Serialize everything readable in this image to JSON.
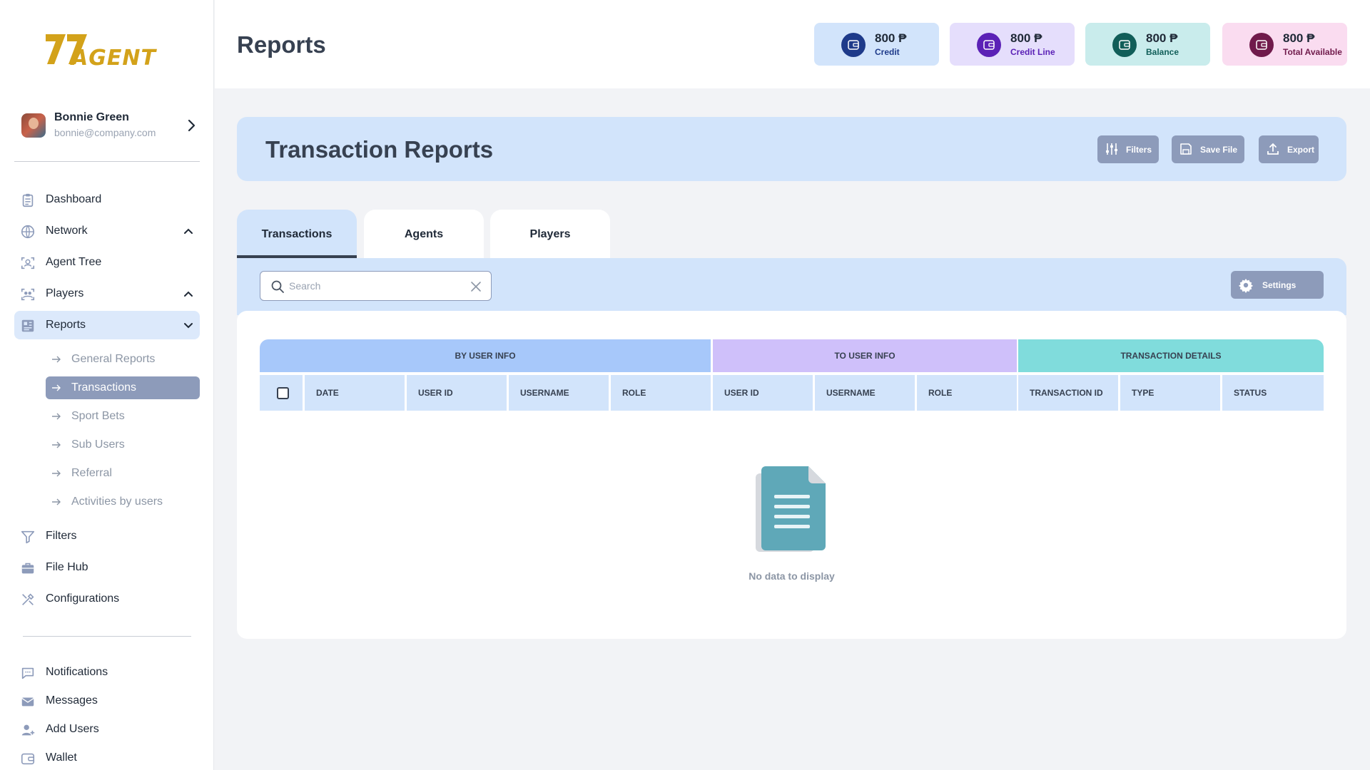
{
  "brand": {
    "logo_text": "AGENT"
  },
  "profile": {
    "name": "Bonnie Green",
    "email": "bonnie@company.com"
  },
  "nav": {
    "dashboard": "Dashboard",
    "network": "Network",
    "agent_tree": "Agent Tree",
    "players": "Players",
    "reports": "Reports",
    "reports_sub": [
      "General Reports",
      "Transactions",
      "Sport Bets",
      "Sub Users",
      "Referral",
      "Activities by users"
    ],
    "filters": "Filters",
    "file_hub": "File Hub",
    "configurations": "Configurations",
    "notifications": "Notifications",
    "messages": "Messages",
    "add_users": "Add Users",
    "wallet": "Wallet"
  },
  "header": {
    "title": "Reports"
  },
  "stats": [
    {
      "value": "800 ₱",
      "caption": "Credit",
      "bg": "#d2e4fb",
      "circle": "#1e3a8a",
      "capColor": "#1e3a8a"
    },
    {
      "value": "800 ₱",
      "caption": "Credit Line",
      "bg": "#e5defc",
      "circle": "#5b21b6",
      "capColor": "#5b21b6"
    },
    {
      "value": "800 ₱",
      "caption": "Balance",
      "bg": "#c9ecec",
      "circle": "#115e59",
      "capColor": "#115e59"
    },
    {
      "value": "800 ₱",
      "caption": "Total Available",
      "bg": "#fadcf0",
      "circle": "#701a4b",
      "capColor": "#701a4b"
    }
  ],
  "report": {
    "title": "Transaction Reports",
    "filters_label": "Filters",
    "save_label": "Save File",
    "export_label": "Export"
  },
  "tabs": [
    "Transactions",
    "Agents",
    "Players"
  ],
  "search": {
    "placeholder": "Search",
    "value": ""
  },
  "settings_label": "Settings",
  "table": {
    "groups": [
      {
        "label": "BY USER INFO",
        "color": "#a7c8fa"
      },
      {
        "label": "TO USER INFO",
        "color": "#cfc0fa"
      },
      {
        "label": "TRANSACTION DETAILS",
        "color": "#80dcdc"
      }
    ],
    "columns": [
      "DATE",
      "USER ID",
      "USERNAME",
      "ROLE",
      "USER ID",
      "USERNAME",
      "ROLE",
      "TRANSACTION ID",
      "TYPE",
      "STATUS"
    ],
    "empty_text": "No data to display"
  },
  "colors": {
    "accent": "#8d9bba",
    "panel": "#d2e4fb",
    "logo": "#d3a21a"
  }
}
